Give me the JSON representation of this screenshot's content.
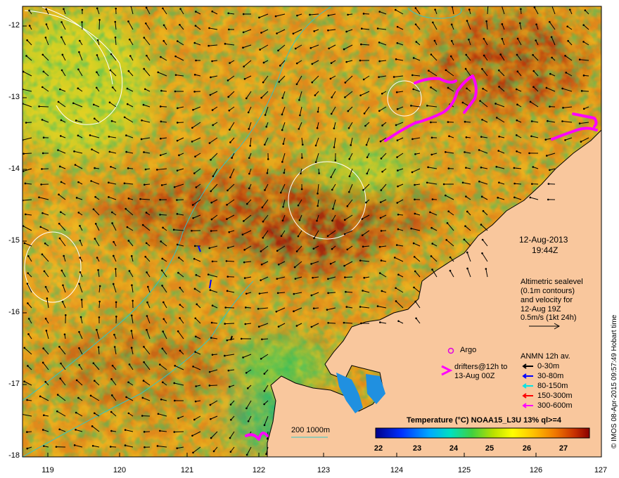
{
  "map": {
    "lat_ticks": [
      "-12",
      "-13",
      "-14",
      "-15",
      "-16",
      "-17",
      "-18"
    ],
    "lon_ticks": [
      "119",
      "120",
      "121",
      "122",
      "123",
      "124",
      "125",
      "126",
      "127"
    ],
    "colors": {
      "land": "#f9c79d",
      "contour": "#ffffff",
      "isobath": "#33c6c6",
      "argo": "#e000e0",
      "drifter": "#ff00ff"
    }
  },
  "info": {
    "date": "12-Aug-2013",
    "time": "19:44Z",
    "altimetry_lines": [
      "Altimetric sealevel",
      "(0.1m contours)",
      "and velocity for",
      "12-Aug 19Z",
      "0.5m/s (1kt 24h)"
    ]
  },
  "legend": {
    "argo": "Argo",
    "drifters_line1": "drifters@12h to",
    "drifters_line2": "13-Aug 00Z",
    "anmn_title": "ANMN 12h av.",
    "anmn_items": [
      {
        "label": "0-30m",
        "color": "#000000"
      },
      {
        "label": "30-80m",
        "color": "#0000ff"
      },
      {
        "label": "80-150m",
        "color": "#00e5e5"
      },
      {
        "label": "150-300m",
        "color": "#ff0000"
      },
      {
        "label": "300-600m",
        "color": "#ff00ff"
      }
    ],
    "isobath_label": "200  1000m"
  },
  "colorbar": {
    "title": "Temperature (°C) NOAA15_L3U 13% ql>=4",
    "ticks": [
      "22",
      "23",
      "24",
      "25",
      "26",
      "27"
    ]
  },
  "copyright": "© IMOS 08-Apr-2015 09:57:49 Hobart time"
}
